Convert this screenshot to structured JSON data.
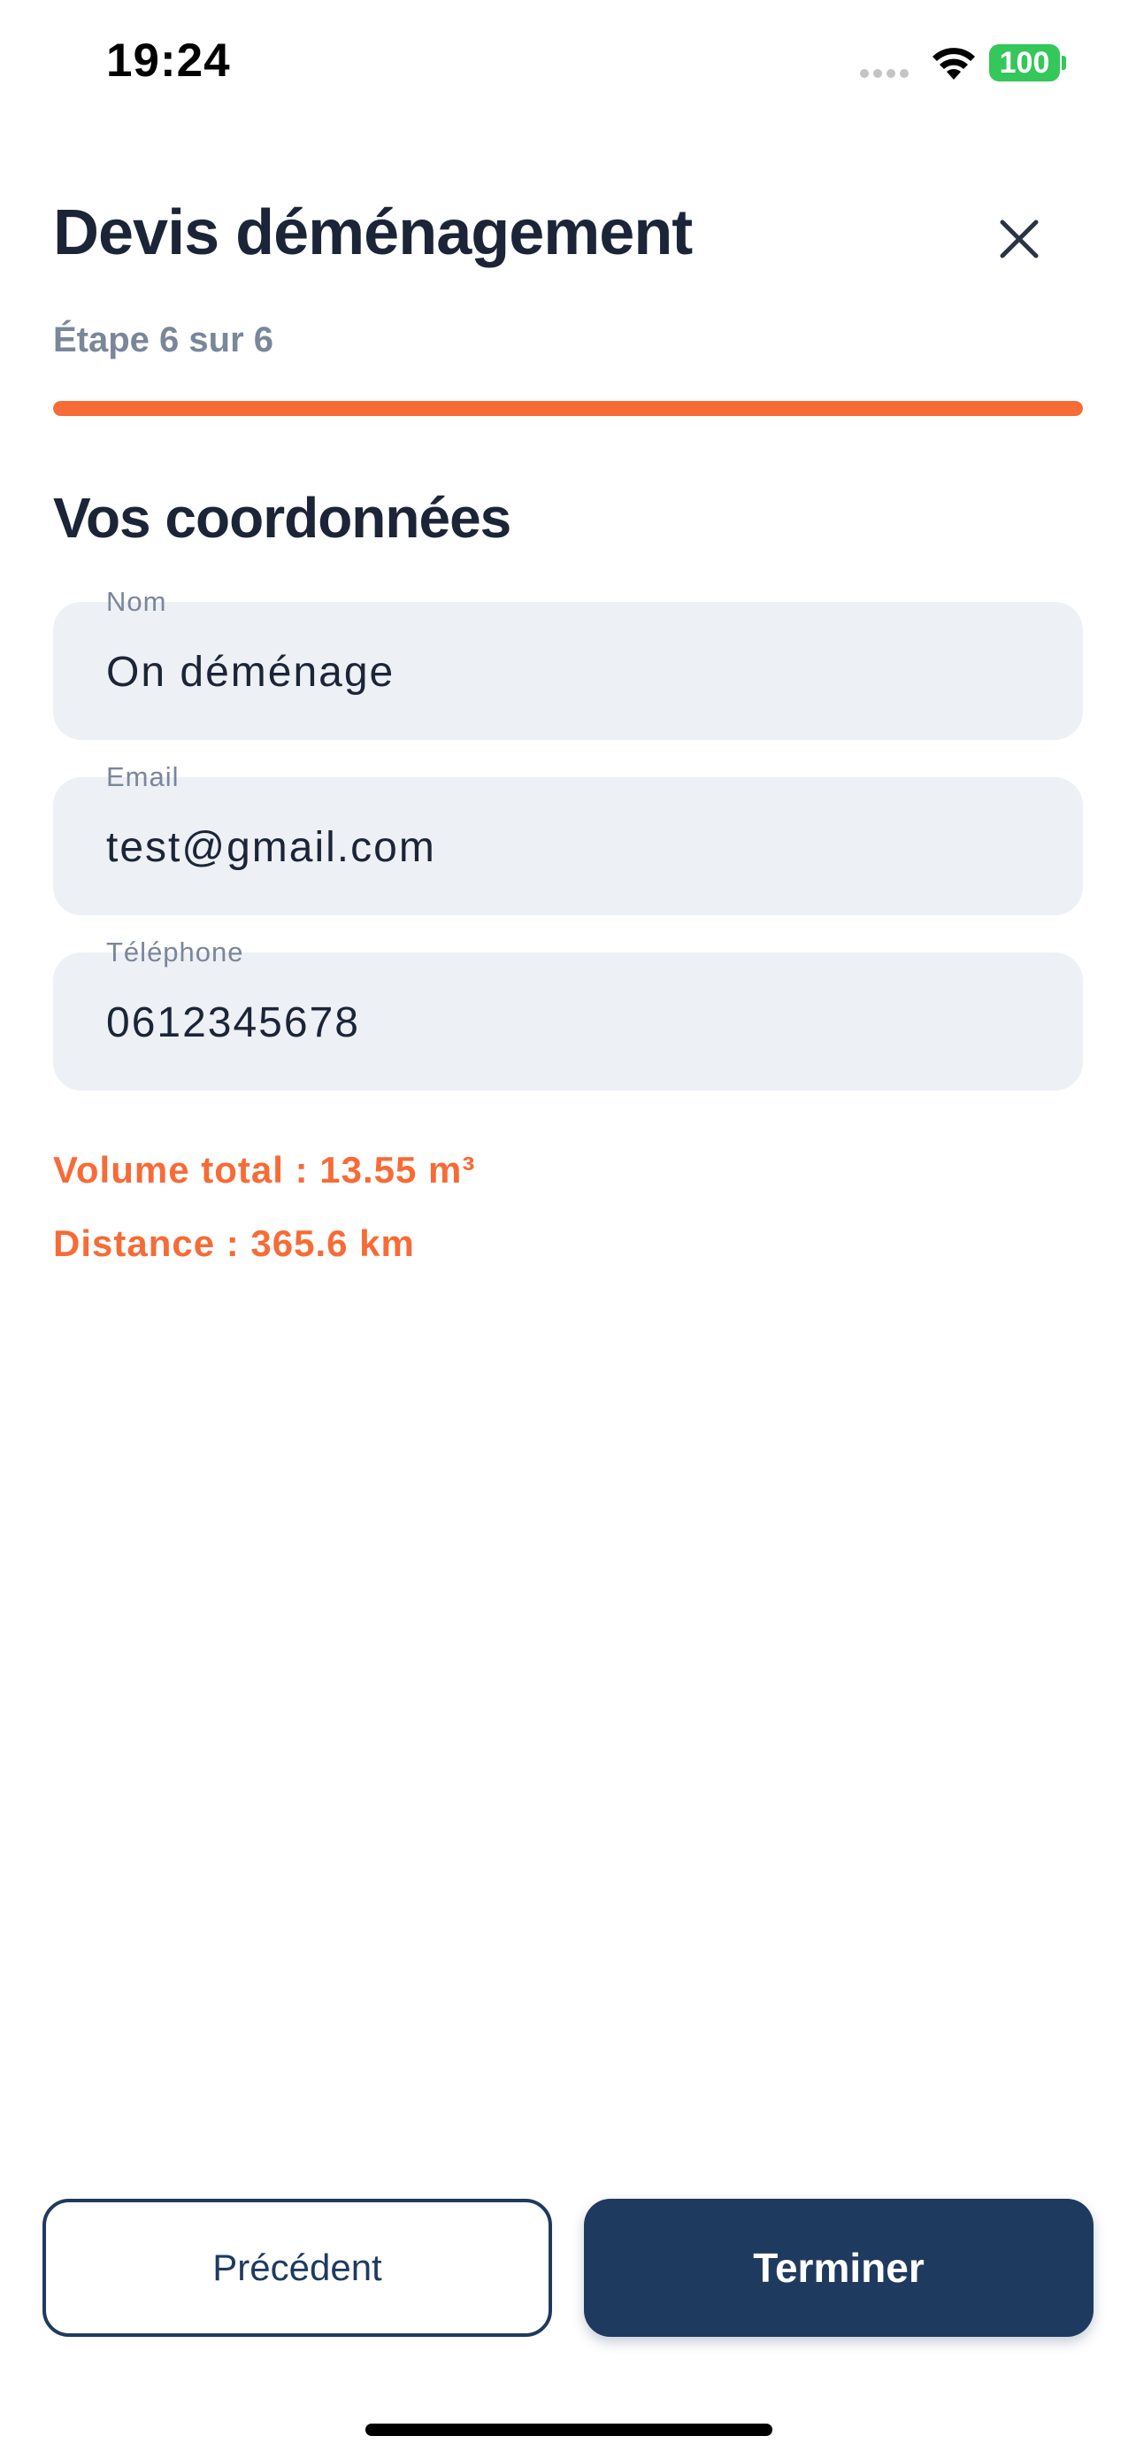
{
  "status_bar": {
    "time": "19:24",
    "battery": "100",
    "battery_color": "#34c759"
  },
  "header": {
    "title": "Devis déménagement",
    "close_icon": "close-icon",
    "step": "Étape 6 sur 6",
    "progress": 1.0
  },
  "section": {
    "title": "Vos coordonnées"
  },
  "fields": [
    {
      "label": "Nom",
      "value": "On déménage"
    },
    {
      "label": "Email",
      "value": "test@gmail.com"
    },
    {
      "label": "Téléphone",
      "value": "0612345678"
    }
  ],
  "summary": {
    "volume": "Volume total : 13.55 m³",
    "distance": "Distance : 365.6 km"
  },
  "actions": {
    "previous_label": "Précédent",
    "finish_label": "Terminer"
  },
  "colors": {
    "accent": "#f76b36",
    "primary": "#1f3a5f",
    "field_bg": "#edf0f5",
    "text": "#1b2537",
    "muted": "#7a869a"
  }
}
